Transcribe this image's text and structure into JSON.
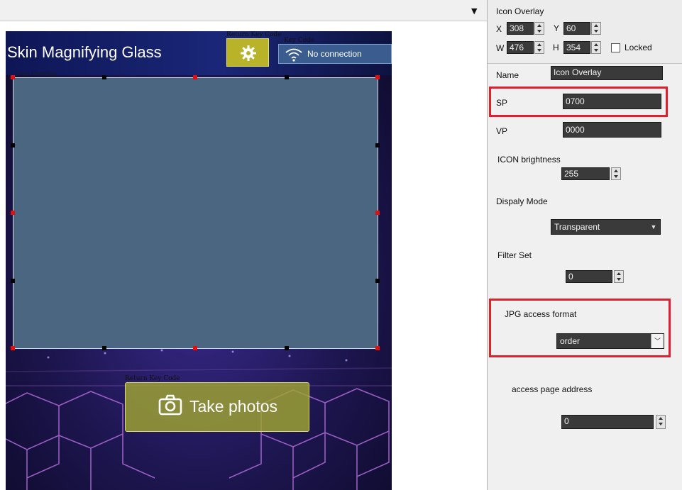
{
  "canvas": {
    "dropdown_glyph": "▼",
    "screen": {
      "title": "Skin Magnifying Glass",
      "settings_tag": "Return Key Code",
      "status_tag": "Key Code",
      "connection_status": "No connection",
      "overlay_tag": "Icon Overlay",
      "button_tag": "Return Key Code",
      "take_photos_label": "Take photos",
      "accent_yellow": "#b9b329",
      "overlay_color": "#4a6680"
    }
  },
  "properties": {
    "title": "Icon Overlay",
    "x_label": "X",
    "x_value": "308",
    "y_label": "Y",
    "y_value": "60",
    "w_label": "W",
    "w_value": "476",
    "h_label": "H",
    "h_value": "354",
    "locked_label": "Locked",
    "locked_checked": false,
    "name_label": "Name",
    "name_value": "Icon Overlay",
    "sp_label": "SP",
    "sp_value": "0700",
    "vp_label": "VP",
    "vp_value": "0000",
    "brightness_label": "ICON brightness",
    "brightness_value": "255",
    "display_mode_label": "Dispaly Mode",
    "display_mode_value": "Transparent",
    "filter_label": "Filter Set",
    "filter_value": "0",
    "jpg_label": "JPG access format",
    "jpg_value": "order",
    "page_address_label": "access page address",
    "page_address_value": "0",
    "highlight_color": "#e0202a"
  }
}
